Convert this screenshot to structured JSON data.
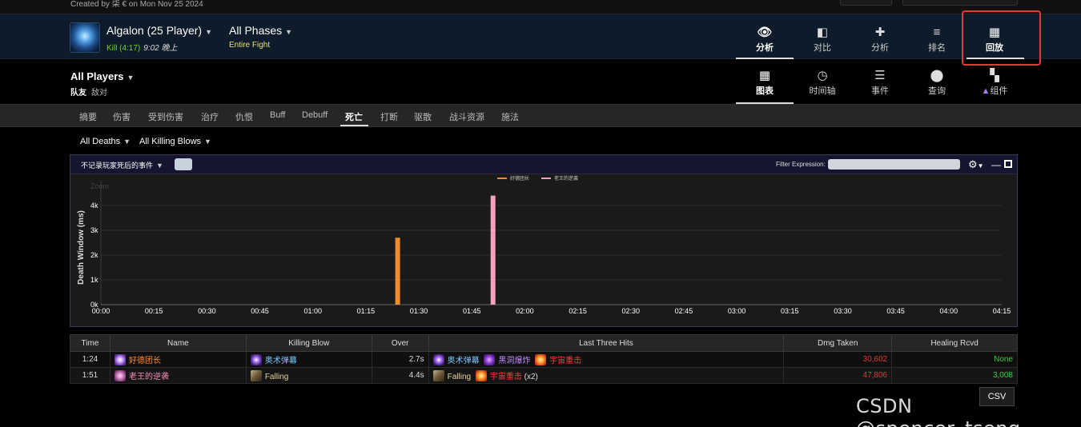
{
  "top": {
    "created_text": "Created by 柒 € on Mon Nov 25 2024"
  },
  "encounter": {
    "boss": "Algalon (25 Player)",
    "kill_label": "Kill (4:17)",
    "kill_time": "9:02 晚上",
    "phase": "All Phases",
    "phase_sub": "Entire Fight"
  },
  "top_nav": [
    {
      "label": "分析",
      "icon": "eye-icon",
      "active": true
    },
    {
      "label": "对比",
      "icon": "compare-icon",
      "active": false
    },
    {
      "label": "分析",
      "icon": "puzzle-icon",
      "active": false
    },
    {
      "label": "排名",
      "icon": "ranking-icon",
      "active": false
    },
    {
      "label": "回放",
      "icon": "replay-icon",
      "active": false
    }
  ],
  "players": {
    "title": "All Players",
    "friendly": "队友",
    "enemy": "敌对"
  },
  "view_nav": [
    {
      "label": "图表",
      "icon": "grid-icon",
      "active": true
    },
    {
      "label": "时间轴",
      "icon": "clock-icon",
      "active": false
    },
    {
      "label": "事件",
      "icon": "list-icon",
      "active": false
    },
    {
      "label": "查询",
      "icon": "pin-icon",
      "active": false
    },
    {
      "label": "组件",
      "icon": "widgets-icon",
      "active": false
    }
  ],
  "tabs": [
    "摘要",
    "伤害",
    "受到伤害",
    "治疗",
    "仇恨",
    "Buff",
    "Debuff",
    "死亡",
    "打断",
    "驱散",
    "战斗资源",
    "施法"
  ],
  "active_tab": "死亡",
  "filters": {
    "deaths": "All Deaths",
    "killing_blows": "All Killing Blows"
  },
  "chart_toolbar": {
    "select_label": "不记录玩家死后的事件",
    "filter_label": "Filter Expression:"
  },
  "chart_data": {
    "type": "bar",
    "ylabel": "Death Window (ms)",
    "zoom_label": "Zoom",
    "yticks": [
      "0k",
      "1k",
      "2k",
      "3k",
      "4k"
    ],
    "ylim": [
      0,
      5000
    ],
    "xticks": [
      "00:00",
      "00:15",
      "00:30",
      "00:45",
      "01:00",
      "01:15",
      "01:30",
      "01:45",
      "02:00",
      "02:15",
      "02:30",
      "02:45",
      "03:00",
      "03:15",
      "03:30",
      "03:45",
      "04:00",
      "04:15"
    ],
    "xlim_seconds": [
      0,
      255
    ],
    "series": [
      {
        "name": "好德团长",
        "color": "#f28c28",
        "x_seconds": 84,
        "value": 2700
      },
      {
        "name": "老王的逆袭",
        "color": "#f5a0c0",
        "x_seconds": 111,
        "value": 4400
      }
    ]
  },
  "table": {
    "headers": [
      "Time",
      "Name",
      "Killing Blow",
      "Over",
      "Last Three Hits",
      "Dmg Taken",
      "Healing Rcvd"
    ],
    "rows": [
      {
        "time": "1:24",
        "name": "好德团长",
        "killing_blow": "奥术弹幕",
        "over": "2.7s",
        "hit1": "奥术弹幕",
        "hit2": "黑洞爆炸",
        "hit3": "宇宙重击",
        "hit3_count": "",
        "dmg_taken": "30,602",
        "healing": "None"
      },
      {
        "time": "1:51",
        "name": "老王的逆袭",
        "killing_blow": "Falling",
        "over": "4.4s",
        "hit1": "Falling",
        "hit2": "宇宙重击",
        "hit3": "",
        "hit3_count": "(x2)",
        "dmg_taken": "47,806",
        "healing": "3,008"
      }
    ]
  },
  "csv_label": "CSV",
  "watermark": "CSDN @spencer_tseng"
}
